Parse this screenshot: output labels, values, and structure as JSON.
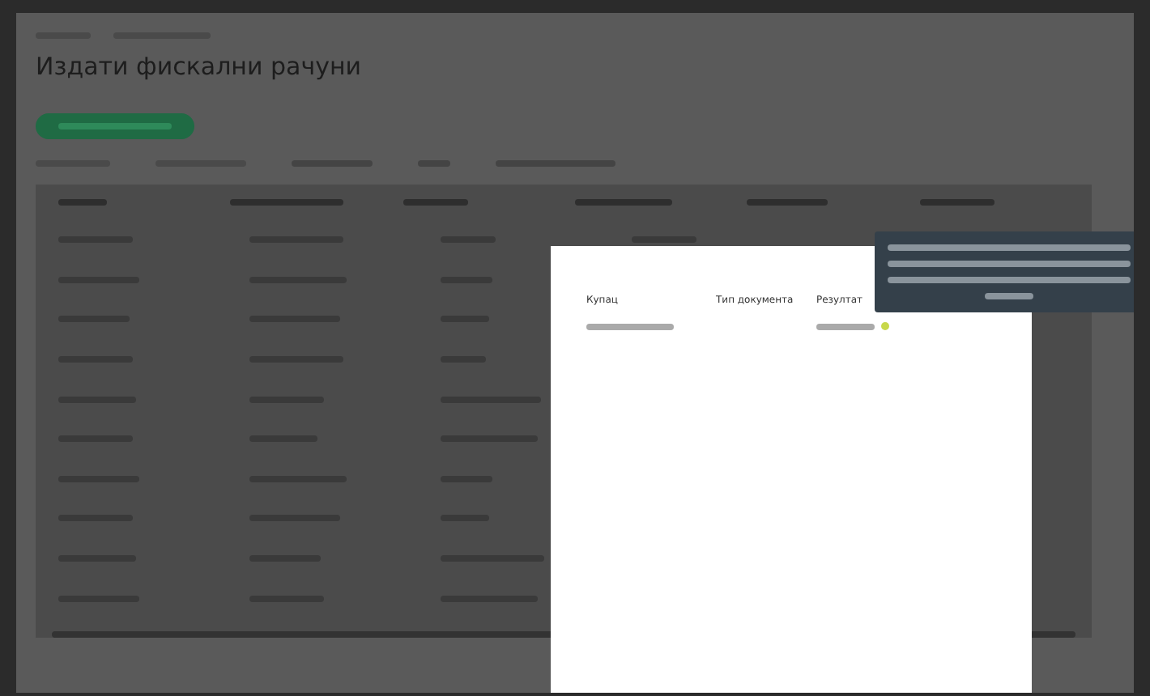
{
  "page": {
    "title": "Издати фискални рачуни"
  },
  "modal": {
    "columns": [
      "Купац",
      "Тип документа",
      "Резултат"
    ],
    "rows": [
      {
        "color": "#c8d84a"
      }
    ]
  }
}
